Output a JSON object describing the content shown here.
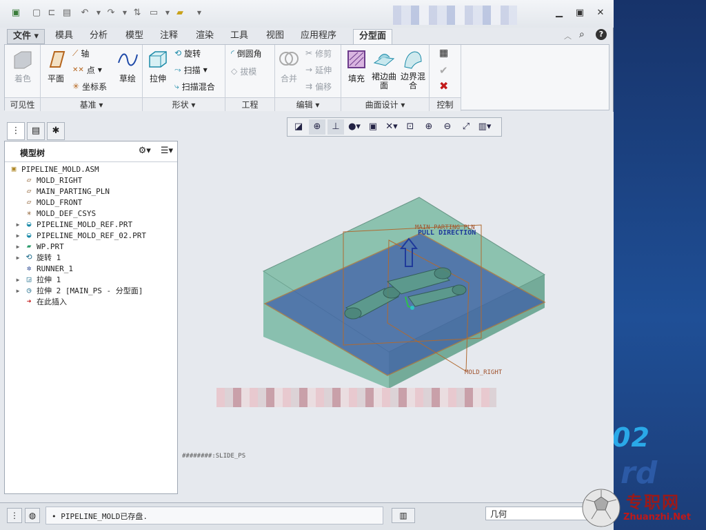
{
  "quick_access": [
    "new-icon",
    "open-icon",
    "save-icon",
    "undo-icon",
    "redo-icon",
    "regenerate-icon",
    "windows-icon",
    "close-window-icon",
    "customize-icon"
  ],
  "ribbon_tabs": [
    {
      "label": "文件",
      "active": false
    },
    {
      "label": "模具",
      "active": false
    },
    {
      "label": "分析",
      "active": false
    },
    {
      "label": "模型",
      "active": false
    },
    {
      "label": "注释",
      "active": false
    },
    {
      "label": "渲染",
      "active": false
    },
    {
      "label": "工具",
      "active": false
    },
    {
      "label": "视图",
      "active": false
    },
    {
      "label": "应用程序",
      "active": false
    },
    {
      "label": "分型面",
      "active": true
    }
  ],
  "ribbon": {
    "visibility": {
      "shade": "着色",
      "group": "可见性"
    },
    "datum": {
      "plane": "平面",
      "axis": "轴",
      "point": "点",
      "csys": "坐标系",
      "sketch": "草绘",
      "group": "基准"
    },
    "shapes": {
      "extrude": "拉伸",
      "revolve": "旋转",
      "sweep": "扫描",
      "swept_blend": "扫描混合",
      "group": "形状"
    },
    "engineering": {
      "round": "倒圆角",
      "draft": "拔模",
      "group": "工程"
    },
    "editing": {
      "merge": "合并",
      "trim": "修剪",
      "extend": "延伸",
      "offset": "偏移",
      "group": "编辑"
    },
    "surface_design": {
      "fill": "填充",
      "skirt": "裙边曲面",
      "boundary_blend": "边界混合",
      "group": "曲面设计"
    },
    "control": {
      "group": "控制"
    }
  },
  "model_tree": {
    "title": "模型树",
    "items": [
      {
        "label": "PIPELINE_MOLD.ASM",
        "icon": "assembly-icon",
        "expandable": false,
        "level": 0
      },
      {
        "label": "MOLD_RIGHT",
        "icon": "datum-plane-icon",
        "expandable": false,
        "level": 1
      },
      {
        "label": "MAIN_PARTING_PLN",
        "icon": "datum-plane-icon",
        "expandable": false,
        "level": 1
      },
      {
        "label": "MOLD_FRONT",
        "icon": "datum-plane-icon",
        "expandable": false,
        "level": 1
      },
      {
        "label": "MOLD_DEF_CSYS",
        "icon": "csys-icon",
        "expandable": false,
        "level": 1
      },
      {
        "label": "PIPELINE_MOLD_REF.PRT",
        "icon": "part-icon",
        "expandable": true,
        "level": 1
      },
      {
        "label": "PIPELINE_MOLD_REF_02.PRT",
        "icon": "part-icon",
        "expandable": true,
        "level": 1
      },
      {
        "label": "WP.PRT",
        "icon": "workpiece-icon",
        "expandable": true,
        "level": 1
      },
      {
        "label": "旋转 1",
        "icon": "revolve-icon",
        "expandable": true,
        "level": 1
      },
      {
        "label": "RUNNER_1",
        "icon": "runner-icon",
        "expandable": false,
        "level": 1
      },
      {
        "label": "拉伸 1",
        "icon": "extrude-icon",
        "expandable": true,
        "level": 1
      },
      {
        "label": "拉伸 2 [MAIN_PS - 分型面]",
        "icon": "surface-icon",
        "expandable": true,
        "level": 1
      },
      {
        "label": "在此插入",
        "icon": "insert-here-icon",
        "expandable": false,
        "level": 1
      }
    ]
  },
  "viewport": {
    "annotations": {
      "plane_top": "MAIN_PARTING_PLN",
      "pull": "PULL DIRECTION",
      "plane_right": "MOLD_RIGHT"
    },
    "slide_label": "########:SLIDE_PS"
  },
  "status": {
    "message": "• PIPELINE_MOLD已存盘.",
    "filter": "几何"
  },
  "watermark": {
    "cn": "专职网",
    "en": "Zhuanzhi.Net",
    "bg_number": "02"
  },
  "colors": {
    "workpiece": "#4f9c84",
    "parting_surface": "#3b5aa8",
    "annotation": "#a0522d",
    "pull_arrow": "#1f3a9a"
  }
}
